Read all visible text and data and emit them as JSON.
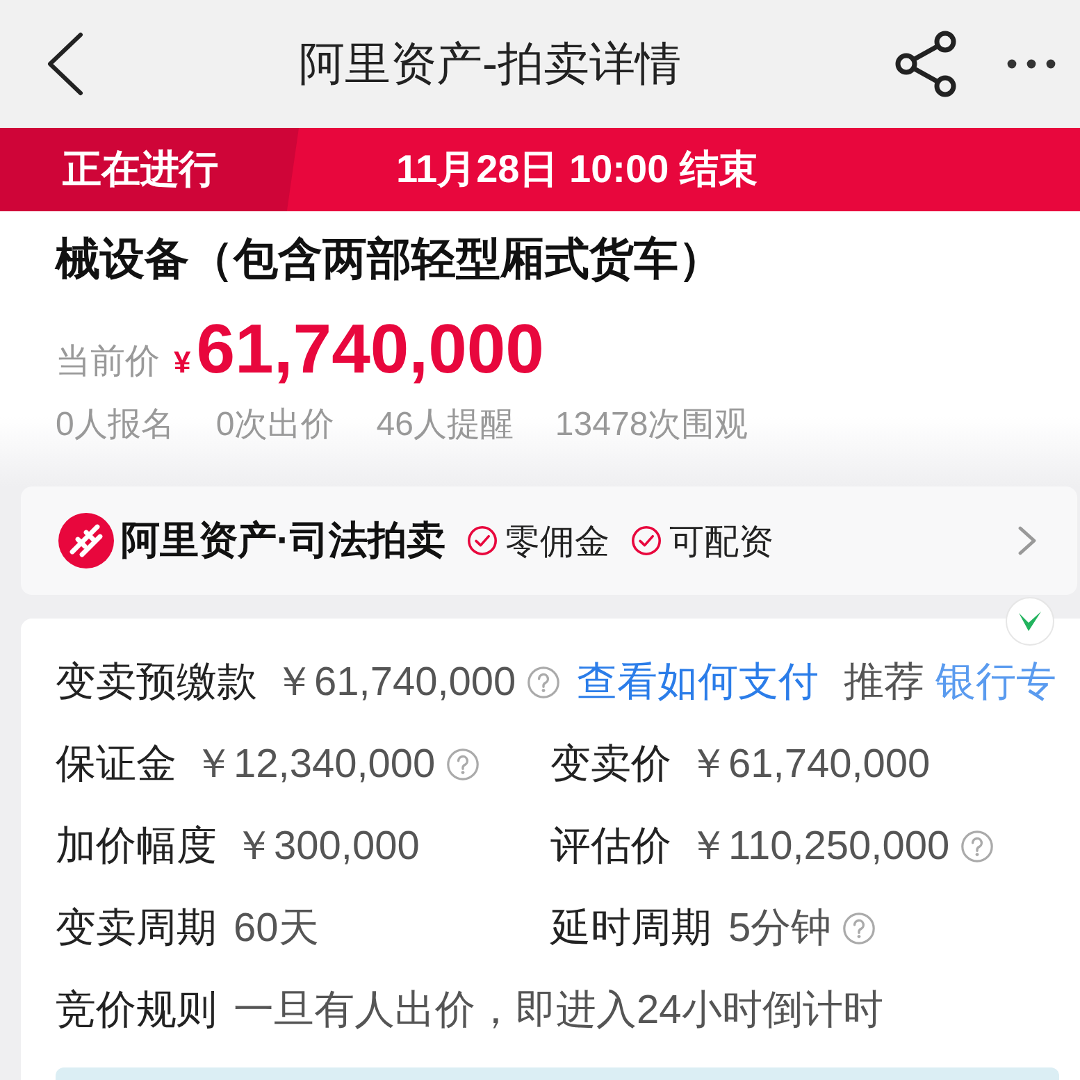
{
  "header": {
    "title": "阿里资产-拍卖详情"
  },
  "status_banner": {
    "status": "正在进行",
    "end_time": "11月28日 10:00 结束"
  },
  "lot": {
    "title": "械设备（包含两部轻型厢式货车）",
    "price_label": "当前价",
    "currency": "¥",
    "price": "61,740,000",
    "stats": [
      "0人报名",
      "0次出价",
      "46人提醒",
      "13478次围观"
    ]
  },
  "brand_card": {
    "name": "阿里资产·司法拍卖",
    "badges": [
      "零佣金",
      "可配资"
    ]
  },
  "details": {
    "deposit": {
      "label": "变卖预缴款",
      "value": "￥61,740,000",
      "help": true,
      "link": "查看如何支付",
      "recommend_label": "推荐",
      "recommend_link": "银行专"
    },
    "grid": [
      {
        "label": "保证金",
        "value": "￥12,340,000",
        "help": true
      },
      {
        "label": "变卖价",
        "value": "￥61,740,000",
        "help": false
      },
      {
        "label": "加价幅度",
        "value": "￥300,000",
        "help": false
      },
      {
        "label": "评估价",
        "value": "￥110,250,000",
        "help": true
      },
      {
        "label": "变卖周期",
        "value": "60天",
        "help": false
      },
      {
        "label": "延时周期",
        "value": "5分钟",
        "help": true
      }
    ],
    "rule": {
      "label": "竞价规则",
      "value": "一旦有人出价，即进入24小时倒计时"
    }
  }
}
